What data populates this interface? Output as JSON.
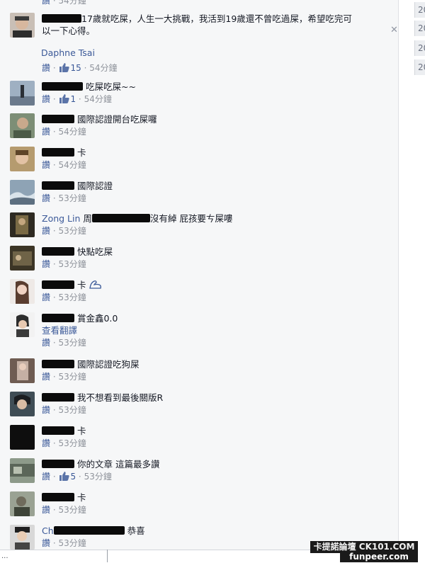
{
  "main_post": {
    "text": "17歲就吃屎，人生一大挑戰，我活到19歲還不曾吃過屎，希望吃完可以一下心得。",
    "text_line1": "17歲就吃屎，人生一大挑戰，我活到19歲還不曾吃過屎，希望吃完可",
    "text_line2": "以一下心得。",
    "reply_name": "Daphne Tsai",
    "read": "讚",
    "like_count": "15",
    "time": "54分鐘"
  },
  "close_symbol": "✕",
  "top_time": "54分鐘",
  "comments": [
    {
      "text": "吃屎吃屎~~",
      "read": "讚",
      "like_count": "1",
      "time": "54分鐘"
    },
    {
      "text": "國際認證開台吃屎囉",
      "read": "讚",
      "time": "54分鐘"
    },
    {
      "text": "卡",
      "read": "讚",
      "time": "54分鐘"
    },
    {
      "text": "國際認證",
      "read": "讚",
      "time": "53分鐘"
    },
    {
      "name_prefix": "Zong Lin",
      "text_prefix": "周",
      "text": "沒有綽 屁孩要ㄘ屎嘍",
      "read": "讚",
      "time": "53分鐘"
    },
    {
      "text": "快點吃屎",
      "read": "讚",
      "time": "53分鐘"
    },
    {
      "text": "卡",
      "read": "讚",
      "time": "53分鐘"
    },
    {
      "text": "賞金鑫0.0",
      "translate": "查看翻譯",
      "read": "讚",
      "time": "53分鐘"
    },
    {
      "text": "國際認證吃狗屎",
      "read": "讚",
      "time": "53分鐘"
    },
    {
      "text": "我不想看到最後關版R",
      "read": "讚",
      "time": "53分鐘"
    },
    {
      "text": "卡",
      "read": "讚",
      "time": "53分鐘"
    },
    {
      "text": "你的文章 這篇最多讚",
      "read": "讚",
      "like_count": "5",
      "time": "53分鐘"
    },
    {
      "text": "卡",
      "read": "讚",
      "time": "53分鐘"
    },
    {
      "name_prefix": "Ch",
      "text": "恭喜",
      "read": "讚",
      "time": "53分鐘"
    }
  ],
  "right_years": [
    "20",
    "20",
    "20",
    "20"
  ],
  "watermark": {
    "line1": "卡提諾論壇 CK101.COM",
    "line2": "funpeer.com"
  },
  "status_url": "...",
  "colors": {
    "link": "#3b5998",
    "meta": "#90949c",
    "background": "#f6f7f8"
  }
}
